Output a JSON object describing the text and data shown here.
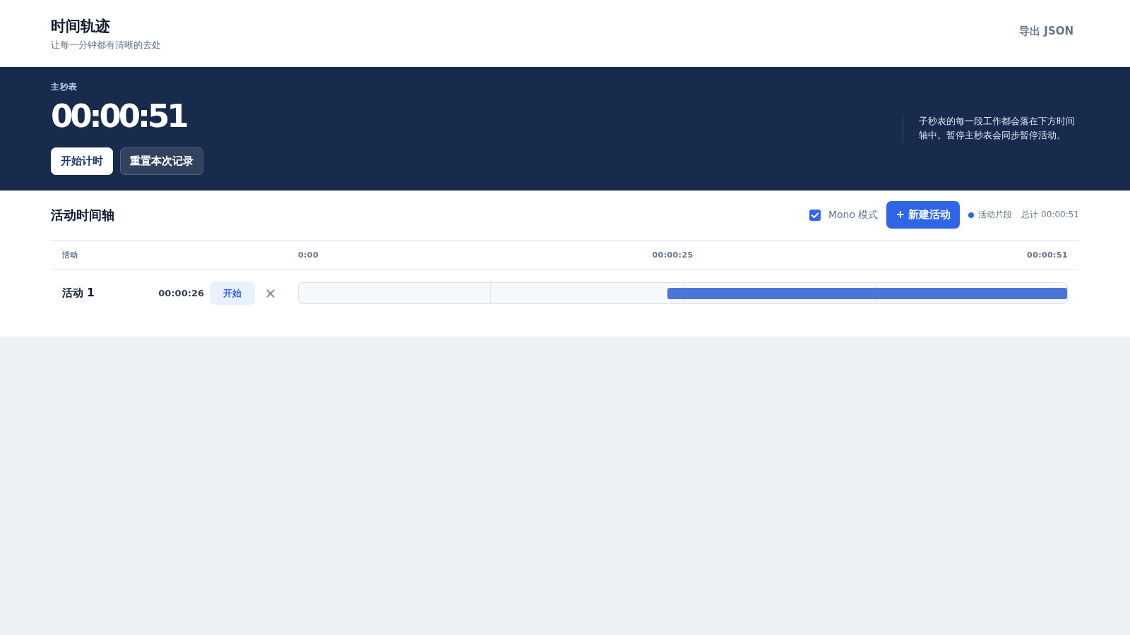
{
  "header": {
    "title": "时间轨迹",
    "subtitle": "让每一分钟都有清晰的去处",
    "export_button": "导出 JSON"
  },
  "stopwatch": {
    "label": "主秒表",
    "time": "00:00:51",
    "buttons": [
      {
        "label": "开始计时",
        "kind": "primary"
      },
      {
        "label": "重置本次记录",
        "kind": "secondary"
      }
    ],
    "note": "子秒表的每一段工作都会落在下方时间轴中。暂停主秒表会同步暂停活动。"
  },
  "timeline": {
    "title": "活动时间轴",
    "mono_mode": {
      "label": "Mono 模式",
      "checked": true
    },
    "new_button": "+ 新建活动",
    "legend": "活动片段",
    "total": "总计 00:00:51",
    "columns": {
      "activity": "活动",
      "ticks": [
        "0:00",
        "00:00:25",
        "00:00:51"
      ]
    },
    "rows": [
      {
        "name": "活动 1",
        "duration": "00:00:26",
        "action": "开始",
        "level": 0.52
      }
    ]
  }
}
